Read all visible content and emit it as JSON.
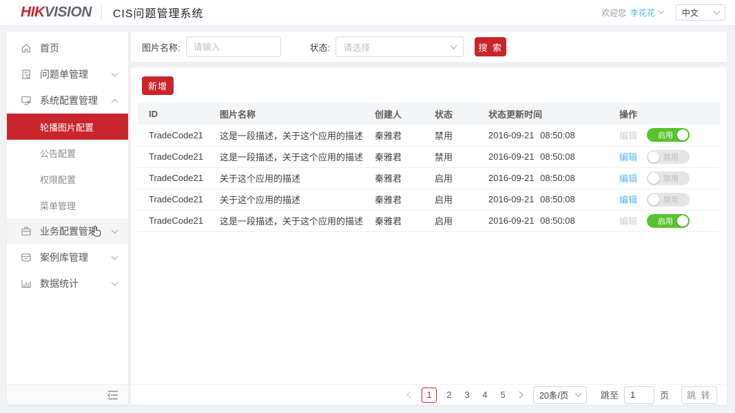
{
  "header": {
    "logo_part1": "HIK",
    "logo_part2": "VISION",
    "title": "CIS问题管理系统",
    "welcome_label": "欢迎您",
    "username": "李花花",
    "language": "中文"
  },
  "sidebar": {
    "items": [
      {
        "label": "首页",
        "icon": "home-icon"
      },
      {
        "label": "问题单管理",
        "icon": "ticket-icon"
      },
      {
        "label": "系统配置管理",
        "icon": "system-config-icon",
        "expanded": true,
        "children": [
          {
            "label": "轮播图片配置",
            "active": true
          },
          {
            "label": "公告配置"
          },
          {
            "label": "权限配置"
          },
          {
            "label": "菜单管理"
          }
        ]
      },
      {
        "label": "业务配置管理",
        "icon": "briefcase-icon",
        "hovered": true
      },
      {
        "label": "案例库管理",
        "icon": "case-icon"
      },
      {
        "label": "数据统计",
        "icon": "stats-icon"
      }
    ]
  },
  "search": {
    "name_label": "图片名称:",
    "name_placeholder": "请输入",
    "status_label": "状态:",
    "status_placeholder": "请选择",
    "search_button": "搜 索"
  },
  "table": {
    "add_button": "新增",
    "edit_label": "编辑",
    "columns": [
      "ID",
      "图片名称",
      "创建人",
      "状态",
      "状态更新时间",
      "操作"
    ],
    "rows": [
      {
        "id": "TradeCode21",
        "name": "这是一段描述，关于这个应用的描述",
        "creator": "秦雅君",
        "status": "禁用",
        "updated": "2016-09-21 08:50:08",
        "edit_enabled": false,
        "toggle_on": true,
        "toggle_label": "启用"
      },
      {
        "id": "TradeCode21",
        "name": "这是一段描述，关于这个应用的描述",
        "creator": "秦雅君",
        "status": "禁用",
        "updated": "2016-09-21 08:50:08",
        "edit_enabled": true,
        "toggle_on": false,
        "toggle_label": "禁用"
      },
      {
        "id": "TradeCode21",
        "name": "关于这个应用的描述",
        "creator": "秦雅君",
        "status": "启用",
        "updated": "2016-09-21 08:50:08",
        "edit_enabled": true,
        "toggle_on": false,
        "toggle_label": "禁用"
      },
      {
        "id": "TradeCode21",
        "name": "关于这个应用的描述",
        "creator": "秦雅君",
        "status": "启用",
        "updated": "2016-09-21 08:50:08",
        "edit_enabled": true,
        "toggle_on": false,
        "toggle_label": "禁用"
      },
      {
        "id": "TradeCode21",
        "name": "这是一段描述，关于这个应用的描述",
        "creator": "秦雅君",
        "status": "启用",
        "updated": "2016-09-21 08:50:08",
        "edit_enabled": false,
        "toggle_on": true,
        "toggle_label": "启用"
      }
    ]
  },
  "pagination": {
    "pages": [
      "1",
      "2",
      "3",
      "4",
      "5"
    ],
    "current_page": "1",
    "page_size": "20条/页",
    "jump_label": "跳至",
    "jump_value": "1",
    "page_unit": "页",
    "jump_button": "跳 转"
  },
  "colors": {
    "brand_red": "#c9252c",
    "link_blue": "#54b8f5",
    "toggle_green": "#57c22d",
    "username_blue": "#56b6f3",
    "page_background": "#f0f2f5"
  }
}
